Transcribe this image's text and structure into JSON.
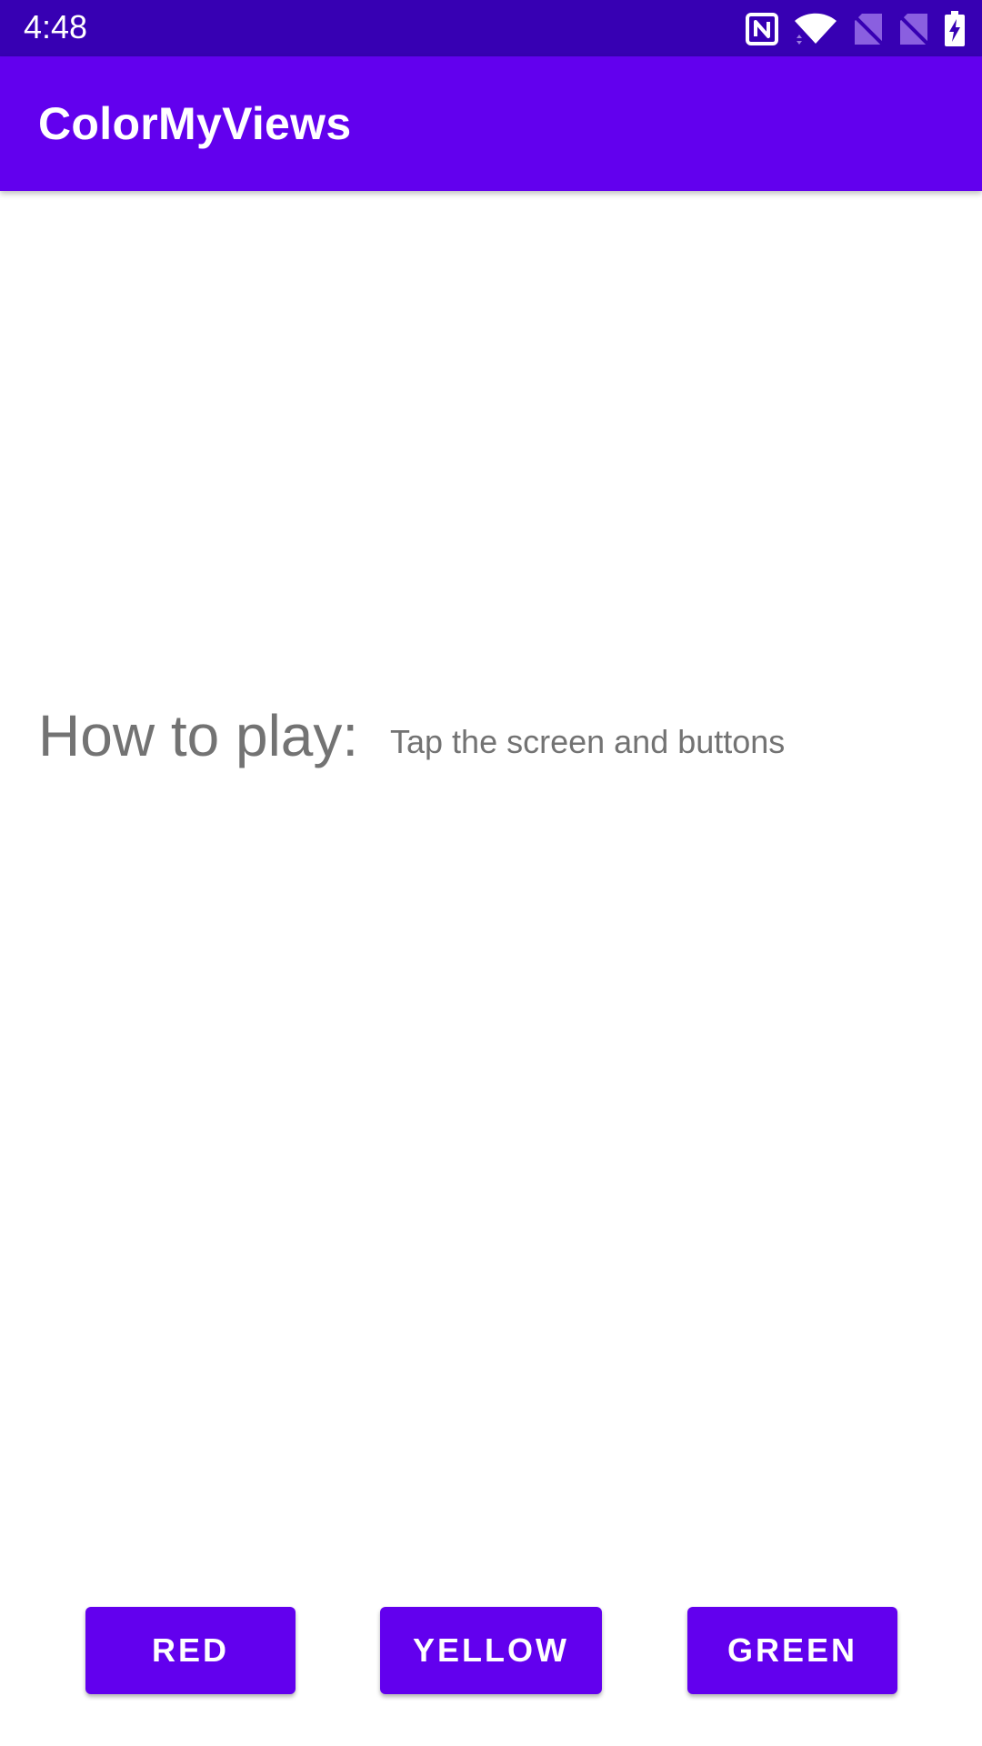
{
  "status_bar": {
    "time": "4:48",
    "icons": [
      "nfc-icon",
      "wifi-icon",
      "sim-no-signal-icon",
      "sim-no-signal-icon",
      "battery-charging-icon"
    ],
    "background": "#3700b3"
  },
  "app_bar": {
    "title": "ColorMyViews",
    "background": "#6200ee"
  },
  "content": {
    "how_to_label": "How to play:",
    "how_to_text": "Tap the screen and buttons",
    "text_color": "#737373"
  },
  "buttons": {
    "red_label": "RED",
    "yellow_label": "YELLOW",
    "green_label": "GREEN",
    "color": "#6200ee"
  }
}
